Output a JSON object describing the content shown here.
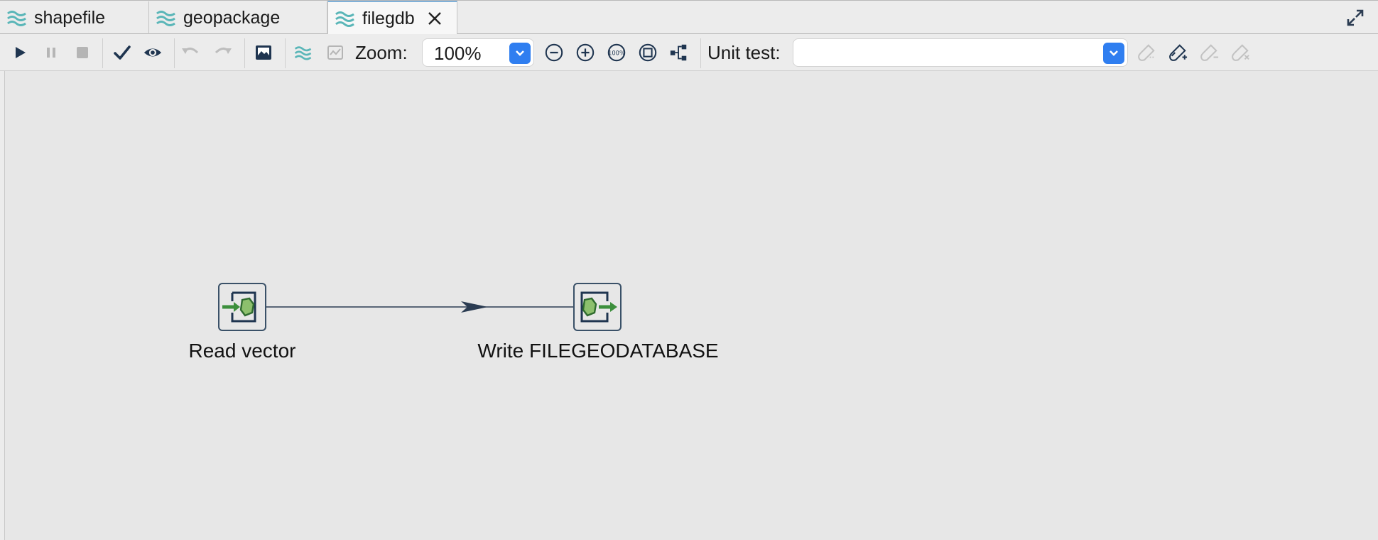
{
  "tabs": [
    {
      "label": "shapefile",
      "icon": "transformation-icon",
      "active": false
    },
    {
      "label": "geopackage",
      "icon": "transformation-icon",
      "active": false
    },
    {
      "label": "filegdb",
      "icon": "transformation-icon",
      "active": true
    }
  ],
  "toolbar": {
    "zoom_label": "Zoom:",
    "zoom_value": "100%",
    "unit_test_label": "Unit test:",
    "unit_test_value": ""
  },
  "canvas": {
    "nodes": [
      {
        "label": "Read vector",
        "icon": "read-vector-icon"
      },
      {
        "label": "Write FILEGEODATABASE",
        "icon": "write-vector-icon"
      }
    ]
  },
  "colors": {
    "accent": "#2f7ef0",
    "tab_icon": "#5ab6b8",
    "step_green": "#3c8f3c",
    "node_border": "#3a5168",
    "icon_dark": "#1f3550"
  }
}
